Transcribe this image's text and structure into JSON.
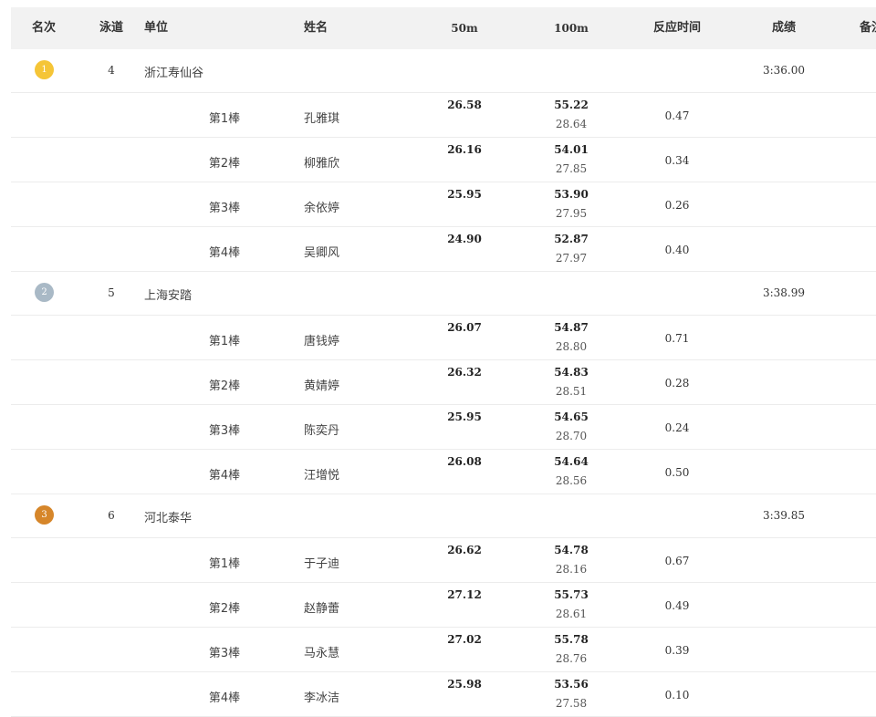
{
  "header": {
    "rank": "名次",
    "lane": "泳道",
    "unit": "单位",
    "name": "姓名",
    "split50": "50m",
    "split100": "100m",
    "reaction": "反应时间",
    "result": "成绩",
    "note": "备注"
  },
  "colors": {
    "gold": "#f5c537",
    "silver": "#a9b9c6",
    "bronze": "#d6862a",
    "header_bg": "#f2f2f2",
    "row_border": "#ececec"
  },
  "teams": [
    {
      "rank": "1",
      "medal": "gold",
      "lane": "4",
      "unit": "浙江寿仙谷",
      "result": "3:36.00",
      "swimmers": [
        {
          "leg": "第1棒",
          "name": "孔雅琪",
          "split50": "26.58",
          "split100": "55.22",
          "split100_sub": "28.64",
          "reaction": "0.47"
        },
        {
          "leg": "第2棒",
          "name": "柳雅欣",
          "split50": "26.16",
          "split100": "54.01",
          "split100_sub": "27.85",
          "reaction": "0.34"
        },
        {
          "leg": "第3棒",
          "name": "余依婷",
          "split50": "25.95",
          "split100": "53.90",
          "split100_sub": "27.95",
          "reaction": "0.26"
        },
        {
          "leg": "第4棒",
          "name": "吴卿风",
          "split50": "24.90",
          "split100": "52.87",
          "split100_sub": "27.97",
          "reaction": "0.40"
        }
      ]
    },
    {
      "rank": "2",
      "medal": "silver",
      "lane": "5",
      "unit": "上海安踏",
      "result": "3:38.99",
      "swimmers": [
        {
          "leg": "第1棒",
          "name": "唐钱婷",
          "split50": "26.07",
          "split100": "54.87",
          "split100_sub": "28.80",
          "reaction": "0.71"
        },
        {
          "leg": "第2棒",
          "name": "黄婧婷",
          "split50": "26.32",
          "split100": "54.83",
          "split100_sub": "28.51",
          "reaction": "0.28"
        },
        {
          "leg": "第3棒",
          "name": "陈奕丹",
          "split50": "25.95",
          "split100": "54.65",
          "split100_sub": "28.70",
          "reaction": "0.24"
        },
        {
          "leg": "第4棒",
          "name": "汪增悦",
          "split50": "26.08",
          "split100": "54.64",
          "split100_sub": "28.56",
          "reaction": "0.50"
        }
      ]
    },
    {
      "rank": "3",
      "medal": "bronze",
      "lane": "6",
      "unit": "河北泰华",
      "result": "3:39.85",
      "swimmers": [
        {
          "leg": "第1棒",
          "name": "于子迪",
          "split50": "26.62",
          "split100": "54.78",
          "split100_sub": "28.16",
          "reaction": "0.67"
        },
        {
          "leg": "第2棒",
          "name": "赵静蕾",
          "split50": "27.12",
          "split100": "55.73",
          "split100_sub": "28.61",
          "reaction": "0.49"
        },
        {
          "leg": "第3棒",
          "name": "马永慧",
          "split50": "27.02",
          "split100": "55.78",
          "split100_sub": "28.76",
          "reaction": "0.39"
        },
        {
          "leg": "第4棒",
          "name": "李冰洁",
          "split50": "25.98",
          "split100": "53.56",
          "split100_sub": "27.58",
          "reaction": "0.10"
        }
      ]
    }
  ]
}
